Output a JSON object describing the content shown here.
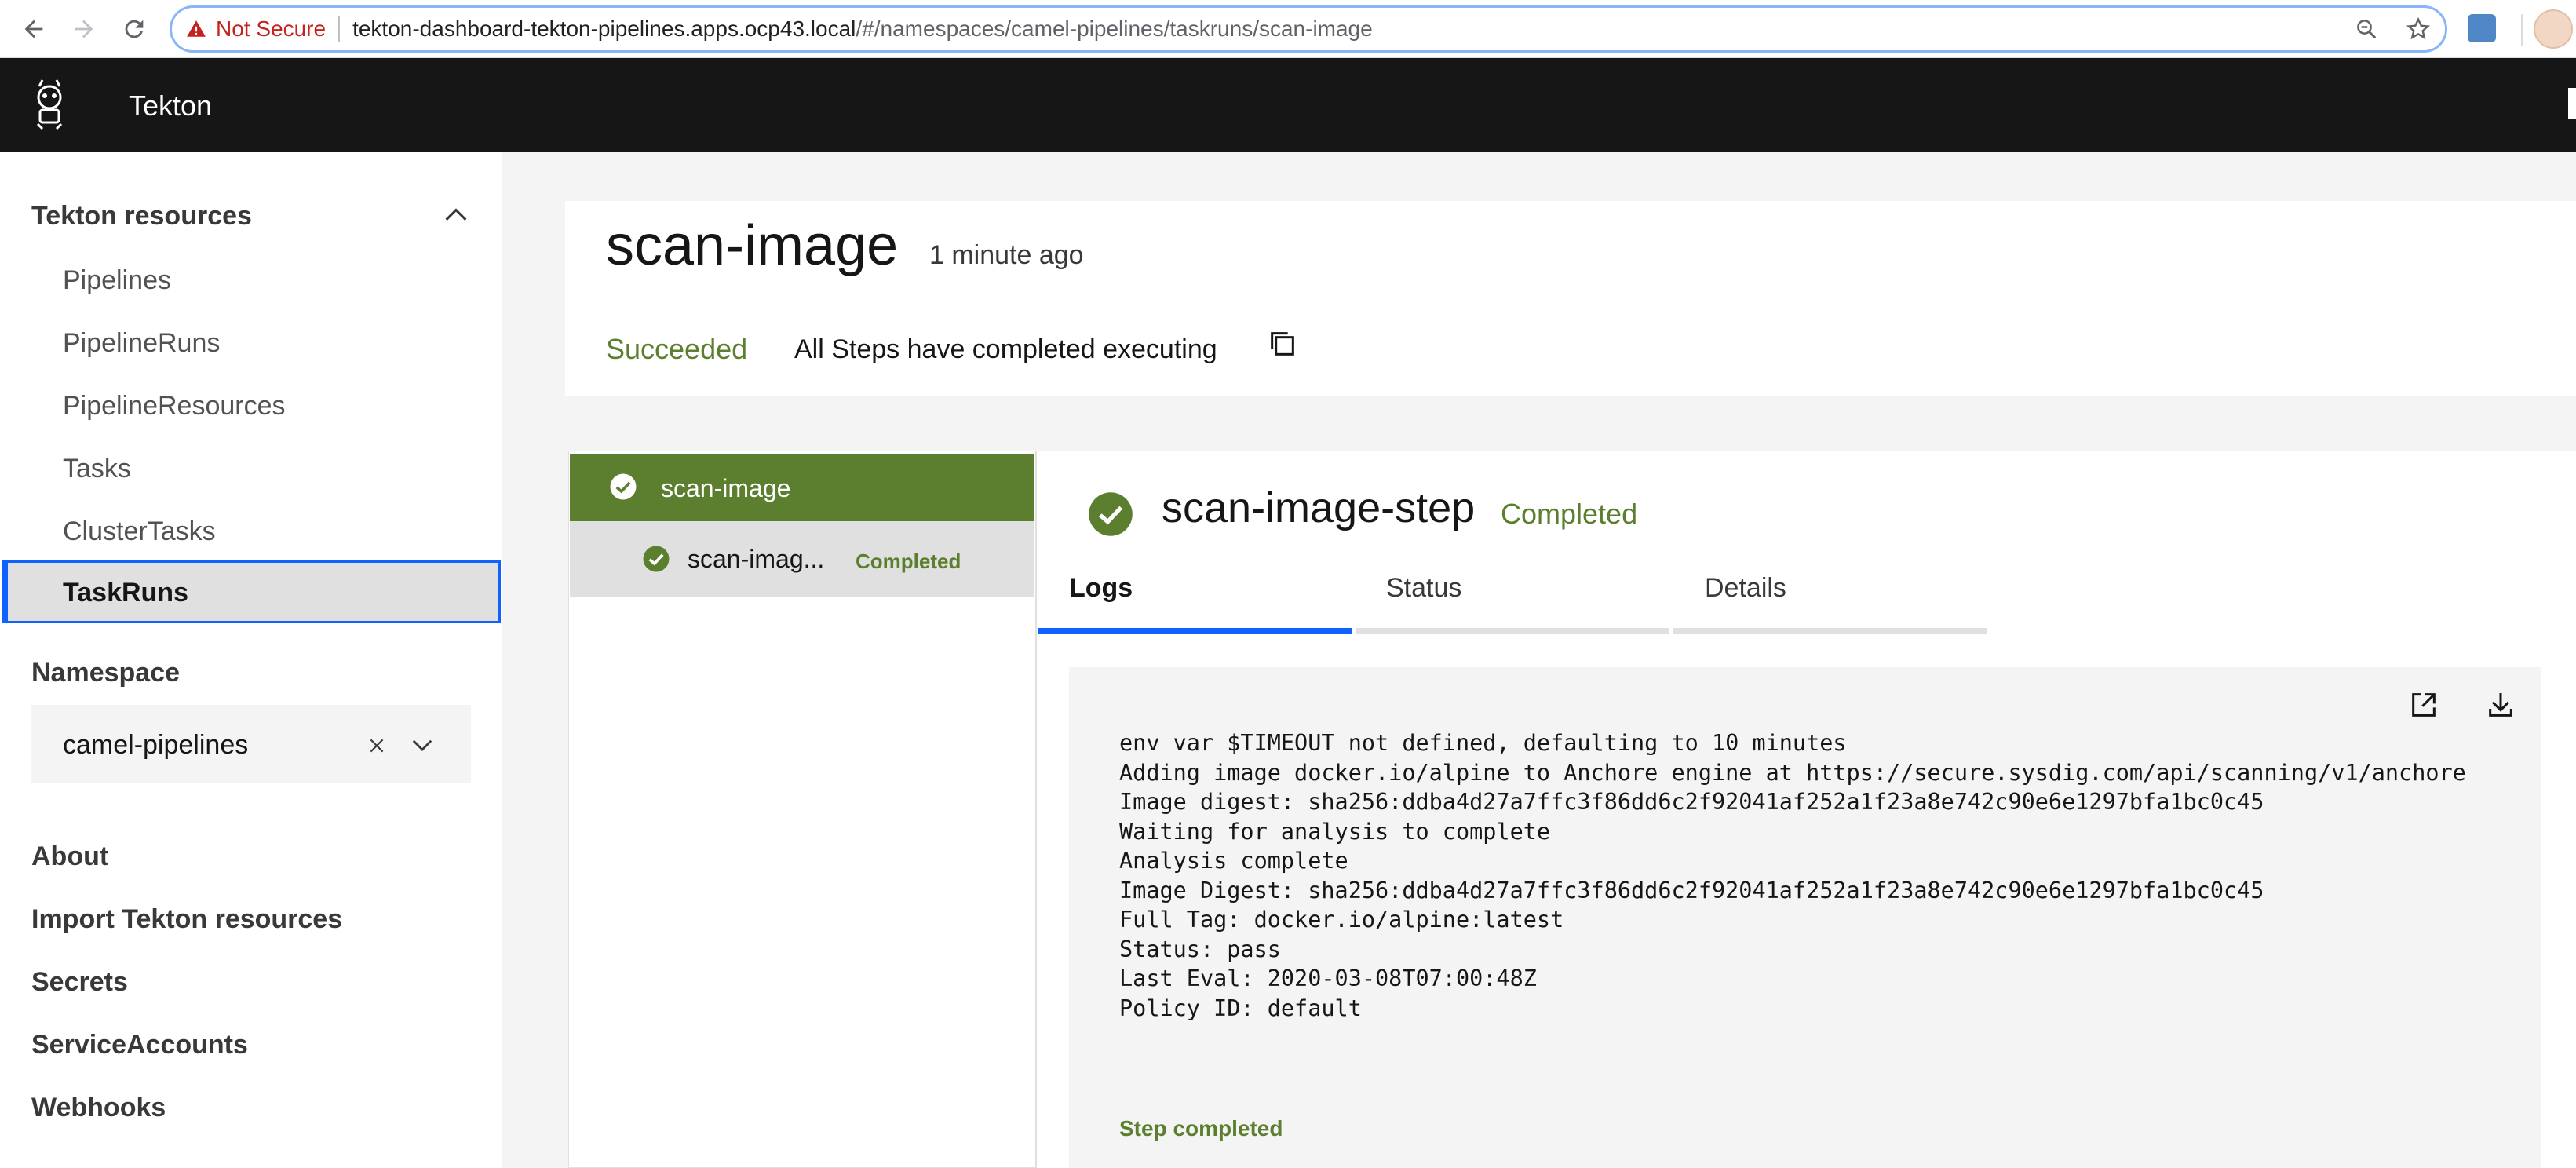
{
  "browser": {
    "security_label": "Not Secure",
    "url_host": "tekton-dashboard-tekton-pipelines.apps.ocp43.local",
    "url_path": "/#/namespaces/camel-pipelines/taskruns/scan-image"
  },
  "app": {
    "title": "Tekton"
  },
  "sidebar": {
    "resources_heading": "Tekton resources",
    "items": [
      "Pipelines",
      "PipelineRuns",
      "PipelineResources",
      "Tasks",
      "ClusterTasks",
      "TaskRuns"
    ],
    "namespace_heading": "Namespace",
    "namespace_value": "camel-pipelines",
    "links": [
      "About",
      "Import Tekton resources",
      "Secrets",
      "ServiceAccounts",
      "Webhooks"
    ]
  },
  "taskrun": {
    "title": "scan-image",
    "time": "1 minute ago",
    "status": "Succeeded",
    "message": "All Steps have completed executing"
  },
  "tree": {
    "task_label": "scan-image",
    "step_label": "scan-imag...",
    "step_status": "Completed"
  },
  "step": {
    "title": "scan-image-step",
    "status": "Completed",
    "tabs": [
      "Logs",
      "Status",
      "Details"
    ]
  },
  "logs": {
    "lines": [
      "env var $TIMEOUT not defined, defaulting to 10 minutes",
      "Adding image docker.io/alpine to Anchore engine at https://secure.sysdig.com/api/scanning/v1/anchore",
      "Image digest: sha256:ddba4d27a7ffc3f86dd6c2f92041af252a1f23a8e742c90e6e1297bfa1bc0c45",
      "Waiting for analysis to complete",
      "Analysis complete",
      "Image Digest: sha256:ddba4d27a7ffc3f86dd6c2f92041af252a1f23a8e742c90e6e1297bfa1bc0c45",
      "Full Tag: docker.io/alpine:latest",
      "Status: pass",
      "Last Eval: 2020-03-08T07:00:48Z",
      "Policy ID: default"
    ],
    "footer": "Step completed"
  },
  "colors": {
    "success": "#5b7f2e",
    "selection": "#0f62fe",
    "header_bg": "#161616"
  }
}
